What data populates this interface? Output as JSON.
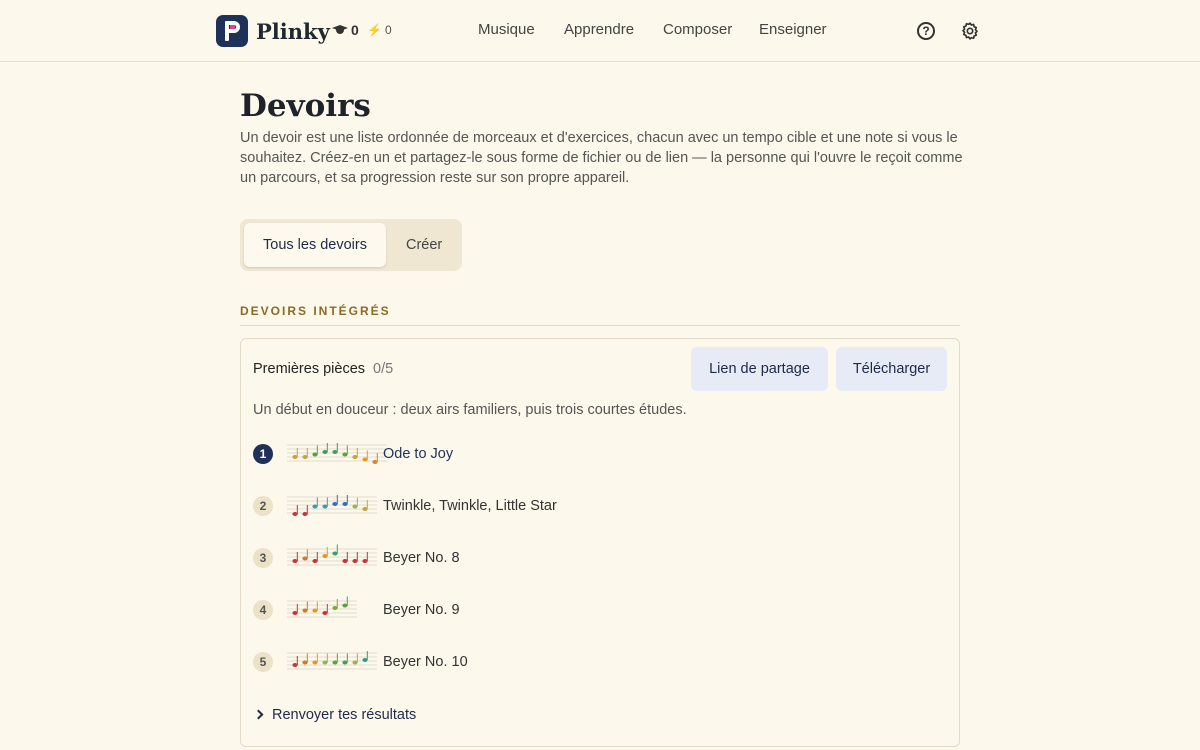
{
  "header": {
    "brand": "Plinky",
    "stat_graduation": "0",
    "stat_energy": "0",
    "nav": [
      "Musique",
      "Apprendre",
      "Composer",
      "Enseigner"
    ],
    "help_glyph": "?"
  },
  "page": {
    "title": "Devoirs",
    "intro": "Un devoir est une liste ordonnée de morceaux et d'exercices, chacun avec un tempo cible et une note si vous le souhaitez. Créez-en un et partagez-le sous forme de fichier ou de lien — la personne qui l'ouvre le reçoit comme un parcours, et sa progression reste sur son propre appareil."
  },
  "tabs": {
    "all": "Tous les devoirs",
    "create": "Créer"
  },
  "section": {
    "label": "DEVOIRS INTÉGRÉS"
  },
  "card": {
    "title": "Premières pièces",
    "count": "0/5",
    "share_label": "Lien de partage",
    "download_label": "Télécharger",
    "description": "Un début en douceur : deux airs familiers, puis trois courtes études.",
    "items": [
      {
        "num": "1",
        "title": "Ode to Joy",
        "active": true,
        "notes": [
          {
            "c": "#c9a23b",
            "h": 0
          },
          {
            "c": "#c9a23b",
            "h": 0
          },
          {
            "c": "#5aa33a",
            "h": 1
          },
          {
            "c": "#3aa060",
            "h": 2
          },
          {
            "c": "#3aa060",
            "h": 2
          },
          {
            "c": "#5aa33a",
            "h": 1
          },
          {
            "c": "#c9a23b",
            "h": 0
          },
          {
            "c": "#e09a2a",
            "h": -1
          },
          {
            "c": "#d1892b",
            "h": -2
          }
        ]
      },
      {
        "num": "2",
        "title": "Twinkle, Twinkle, Little Star",
        "active": false,
        "notes": [
          {
            "c": "#c8333a",
            "h": -2
          },
          {
            "c": "#c8333a",
            "h": -2
          },
          {
            "c": "#3a9fa6",
            "h": 1
          },
          {
            "c": "#3a9fa6",
            "h": 1
          },
          {
            "c": "#2f6fc2",
            "h": 2
          },
          {
            "c": "#2f6fc2",
            "h": 2
          },
          {
            "c": "#9ab35a",
            "h": 1
          },
          {
            "c": "#c9a23b",
            "h": 0
          }
        ]
      },
      {
        "num": "3",
        "title": "Beyer No. 8",
        "active": false,
        "notes": [
          {
            "c": "#c8333a",
            "h": 0
          },
          {
            "c": "#d2782a",
            "h": 1
          },
          {
            "c": "#c8333a",
            "h": 0
          },
          {
            "c": "#e09a2a",
            "h": 2
          },
          {
            "c": "#3aa060",
            "h": 3
          },
          {
            "c": "#c8333a",
            "h": 0
          },
          {
            "c": "#c8333a",
            "h": 0
          },
          {
            "c": "#c8333a",
            "h": 0
          }
        ]
      },
      {
        "num": "4",
        "title": "Beyer No. 9",
        "active": false,
        "notes": [
          {
            "c": "#c8333a",
            "h": 0
          },
          {
            "c": "#d2782a",
            "h": 1
          },
          {
            "c": "#e09a2a",
            "h": 1
          },
          {
            "c": "#c8333a",
            "h": 0
          },
          {
            "c": "#7aaa3a",
            "h": 2
          },
          {
            "c": "#5aa33a",
            "h": 3
          }
        ]
      },
      {
        "num": "5",
        "title": "Beyer No. 10",
        "active": false,
        "notes": [
          {
            "c": "#c8333a",
            "h": 0
          },
          {
            "c": "#d2782a",
            "h": 1
          },
          {
            "c": "#e09a2a",
            "h": 1
          },
          {
            "c": "#9ab35a",
            "h": 1
          },
          {
            "c": "#5aa33a",
            "h": 1
          },
          {
            "c": "#3aa060",
            "h": 1
          },
          {
            "c": "#9ab35a",
            "h": 1
          },
          {
            "c": "#2aa07a",
            "h": 2
          }
        ]
      }
    ],
    "more_label": "Renvoyer tes résultats"
  }
}
